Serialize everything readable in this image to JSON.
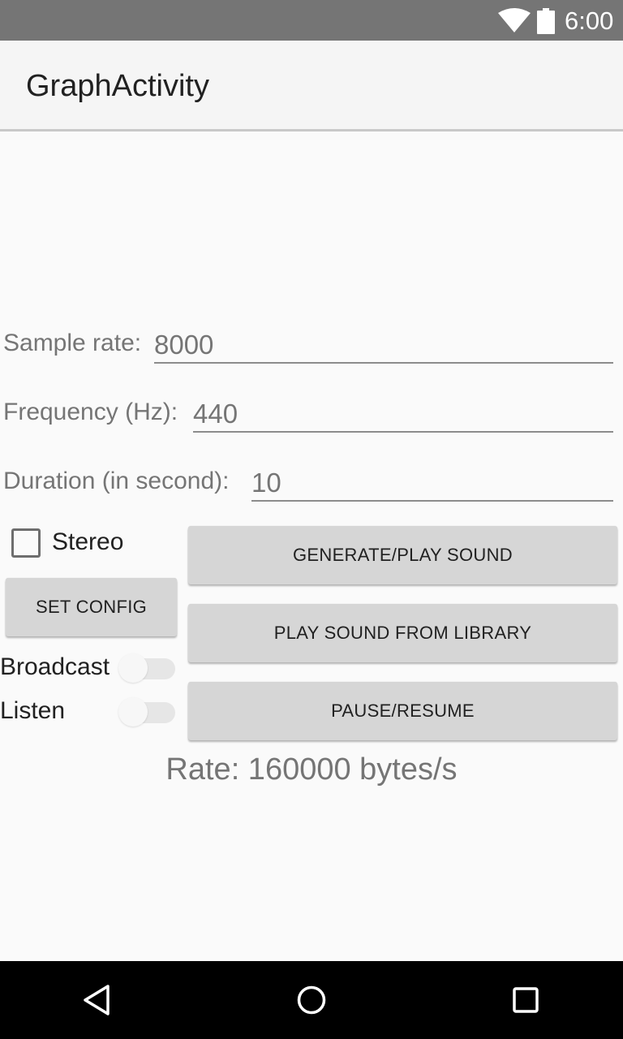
{
  "status_bar": {
    "time": "6:00",
    "icons": [
      "wifi-icon",
      "battery-icon"
    ]
  },
  "app_bar": {
    "title": "GraphActivity"
  },
  "form": {
    "sample_rate": {
      "label": "Sample rate:",
      "value": "8000"
    },
    "frequency": {
      "label": "Frequency (Hz):",
      "value": "440"
    },
    "duration": {
      "label": "Duration (in second):",
      "value": "10"
    },
    "stereo": {
      "label": "Stereo",
      "checked": false
    }
  },
  "buttons": {
    "set_config": "SET CONFIG",
    "generate_play": "GENERATE/PLAY SOUND",
    "play_library": "PLAY SOUND FROM LIBRARY",
    "pause_resume": "PAUSE/RESUME"
  },
  "switches": {
    "broadcast": {
      "label": "Broadcast",
      "on": false
    },
    "listen": {
      "label": "Listen",
      "on": false
    }
  },
  "rate_text": "Rate: 160000 bytes/s",
  "nav_bar": {
    "icons": [
      "back-icon",
      "home-icon",
      "recents-icon"
    ]
  },
  "colors": {
    "status_bar": "#757575",
    "app_bar": "#f5f5f5",
    "background": "#fafafa",
    "button": "#d6d6d6",
    "nav_bar": "#000000"
  }
}
